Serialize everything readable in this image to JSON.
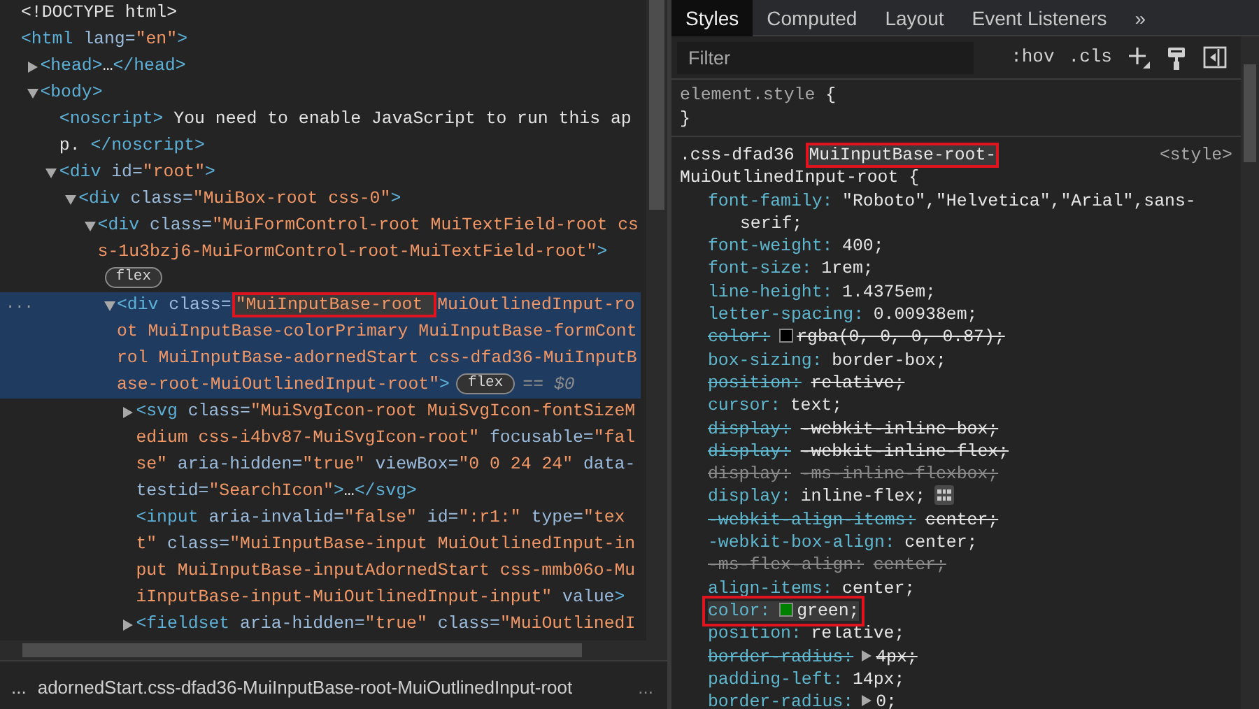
{
  "elements_panel": {
    "row_marker": "...",
    "nodes": [
      {
        "selected": false,
        "segments": [
          {
            "kind": "plain",
            "text": "<!DOCTYPE html>"
          }
        ]
      },
      {
        "selected": false,
        "segments": [
          {
            "kind": "tag",
            "text": "<html"
          },
          {
            "kind": "attr",
            "text": " lang="
          },
          {
            "kind": "value",
            "text": "\"en\""
          },
          {
            "kind": "tag",
            "text": ">"
          }
        ],
        "children": [
          {
            "selected": false,
            "expanded": false,
            "segments": [
              {
                "kind": "tag",
                "text": "<head>"
              },
              {
                "kind": "plain",
                "text": "…"
              },
              {
                "kind": "tag",
                "text": "</head>"
              }
            ]
          },
          {
            "selected": false,
            "expanded": true,
            "segments": [
              {
                "kind": "tag",
                "text": "<body>"
              }
            ],
            "children": [
              {
                "selected": false,
                "segments": [
                  {
                    "kind": "tag",
                    "text": "<noscript>"
                  },
                  {
                    "kind": "plain",
                    "text": " You need to enable JavaScript to run this app. "
                  },
                  {
                    "kind": "tag",
                    "text": "</noscript>"
                  }
                ]
              },
              {
                "selected": false,
                "expanded": true,
                "segments": [
                  {
                    "kind": "tag",
                    "text": "<div"
                  },
                  {
                    "kind": "attr",
                    "text": " id="
                  },
                  {
                    "kind": "value",
                    "text": "\"root\""
                  },
                  {
                    "kind": "tag",
                    "text": ">"
                  }
                ],
                "children": [
                  {
                    "selected": false,
                    "expanded": true,
                    "segments": [
                      {
                        "kind": "tag",
                        "text": "<div"
                      },
                      {
                        "kind": "attr",
                        "text": " class="
                      },
                      {
                        "kind": "value",
                        "text": "\"MuiBox-root css-0\""
                      },
                      {
                        "kind": "tag",
                        "text": ">"
                      }
                    ],
                    "children": [
                      {
                        "selected": false,
                        "expanded": true,
                        "badge": "flex",
                        "segments": [
                          {
                            "kind": "tag",
                            "text": "<div"
                          },
                          {
                            "kind": "attr",
                            "text": " class="
                          },
                          {
                            "kind": "value",
                            "text": "\"MuiFormControl-root MuiTextField-root css-1u3bzj6-MuiFormControl-root-MuiTextField-root\""
                          },
                          {
                            "kind": "tag",
                            "text": ">"
                          }
                        ],
                        "children": [
                          {
                            "selected": true,
                            "expanded": true,
                            "badge": "flex",
                            "suffix": "== $0",
                            "segments": [
                              {
                                "kind": "tag",
                                "text": "<div",
                                "highlighted": false
                              },
                              {
                                "kind": "attr",
                                "text": " class=",
                                "highlighted": false
                              },
                              {
                                "kind": "value",
                                "text": "\"MuiInputBase-root ",
                                "highlighted": true
                              },
                              {
                                "kind": "value",
                                "text": "MuiOutlinedInput-root MuiInputBase-colorPrimary MuiInputBase-formControl MuiInputBase-adornedStart css-dfad36-MuiInputBase-root-MuiOutlinedInput-root\"",
                                "highlighted": false
                              },
                              {
                                "kind": "tag",
                                "text": ">",
                                "highlighted": false
                              }
                            ],
                            "children": [
                              {
                                "selected": false,
                                "expanded": false,
                                "segments": [
                                  {
                                    "kind": "tag",
                                    "text": "<svg"
                                  },
                                  {
                                    "kind": "attr",
                                    "text": " class="
                                  },
                                  {
                                    "kind": "value",
                                    "text": "\"MuiSvgIcon-root MuiSvgIcon-fontSizeMedium css-i4bv87-MuiSvgIcon-root\""
                                  },
                                  {
                                    "kind": "attr",
                                    "text": " focusable="
                                  },
                                  {
                                    "kind": "value",
                                    "text": "\"false\""
                                  },
                                  {
                                    "kind": "attr",
                                    "text": " aria-hidden="
                                  },
                                  {
                                    "kind": "value",
                                    "text": "\"true\""
                                  },
                                  {
                                    "kind": "attr",
                                    "text": " viewBox="
                                  },
                                  {
                                    "kind": "value",
                                    "text": "\"0 0 24 24\""
                                  },
                                  {
                                    "kind": "attr",
                                    "text": " data-testid="
                                  },
                                  {
                                    "kind": "value",
                                    "text": "\"SearchIcon\""
                                  },
                                  {
                                    "kind": "tag",
                                    "text": ">"
                                  },
                                  {
                                    "kind": "plain",
                                    "text": "…"
                                  },
                                  {
                                    "kind": "tag",
                                    "text": "</svg>"
                                  }
                                ]
                              },
                              {
                                "selected": false,
                                "segments": [
                                  {
                                    "kind": "tag",
                                    "text": "<input"
                                  },
                                  {
                                    "kind": "attr",
                                    "text": " aria-invalid="
                                  },
                                  {
                                    "kind": "value",
                                    "text": "\"false\""
                                  },
                                  {
                                    "kind": "attr",
                                    "text": " id="
                                  },
                                  {
                                    "kind": "value",
                                    "text": "\":r1:\""
                                  },
                                  {
                                    "kind": "attr",
                                    "text": " type="
                                  },
                                  {
                                    "kind": "value",
                                    "text": "\"text\""
                                  },
                                  {
                                    "kind": "attr",
                                    "text": " class="
                                  },
                                  {
                                    "kind": "value",
                                    "text": "\"MuiInputBase-input MuiOutlinedInput-input MuiInputBase-inputAdornedStart css-mmb06o-MuiInputBase-input-MuiOutlinedInput-input\""
                                  },
                                  {
                                    "kind": "attr",
                                    "text": " value"
                                  },
                                  {
                                    "kind": "tag",
                                    "text": ">"
                                  }
                                ]
                              },
                              {
                                "selected": false,
                                "expanded": false,
                                "segments": [
                                  {
                                    "kind": "tag",
                                    "text": "<fieldset"
                                  },
                                  {
                                    "kind": "attr",
                                    "text": " aria-hidden="
                                  },
                                  {
                                    "kind": "value",
                                    "text": "\"true\""
                                  },
                                  {
                                    "kind": "attr",
                                    "text": " class="
                                  },
                                  {
                                    "kind": "value",
                                    "text": "\"MuiOutlinedI"
                                  }
                                ]
                              }
                            ]
                          }
                        ]
                      }
                    ]
                  }
                ]
              }
            ]
          }
        ]
      }
    ],
    "breadcrumb": {
      "leading": "...",
      "path": "adornedStart.css-dfad36-MuiInputBase-root-MuiOutlinedInput-root",
      "trailing": "..."
    }
  },
  "styles_panel": {
    "tabs": [
      {
        "label": "Styles",
        "selected": true
      },
      {
        "label": "Computed",
        "selected": false
      },
      {
        "label": "Layout",
        "selected": false
      },
      {
        "label": "Event Listeners",
        "selected": false
      }
    ],
    "more_tabs": "»",
    "filter": {
      "placeholder": "Filter"
    },
    "toolbar_buttons": [
      ":hov",
      ".cls"
    ],
    "rules": [
      {
        "kind": "inline",
        "selector": [
          {
            "text": "element.style",
            "highlighted": false
          }
        ],
        "open": " {",
        "close": "}"
      },
      {
        "kind": "matched",
        "selector": [
          {
            "text": ".css-dfad36 ",
            "highlighted": false
          },
          {
            "text": "MuiInputBase-root-",
            "highlighted": true
          },
          {
            "text": "MuiOutlinedInput-root",
            "highlighted": false
          }
        ],
        "open": " {",
        "source": "<style>",
        "properties": [
          {
            "kind": "plain",
            "name": "font-family:",
            "value": "\"Roboto\",\"Helvetica\",\"Arial\",sans-serif;",
            "overridden": false,
            "invalid": false,
            "highlighted": false
          },
          {
            "kind": "plain",
            "name": "font-weight:",
            "value": "400;",
            "overridden": false,
            "invalid": false,
            "highlighted": false
          },
          {
            "kind": "plain",
            "name": "font-size:",
            "value": "1rem;",
            "overridden": false,
            "invalid": false,
            "highlighted": false
          },
          {
            "kind": "plain",
            "name": "line-height:",
            "value": "1.4375em;",
            "overridden": false,
            "invalid": false,
            "highlighted": false
          },
          {
            "kind": "plain",
            "name": "letter-spacing:",
            "value": "0.00938em;",
            "overridden": false,
            "invalid": false,
            "highlighted": false
          },
          {
            "kind": "swatch",
            "name": "color:",
            "value": "rgba(0, 0, 0, 0.87);",
            "overridden": true,
            "invalid": false,
            "color": "#000000",
            "highlighted": false
          },
          {
            "kind": "plain",
            "name": "box-sizing:",
            "value": "border-box;",
            "overridden": false,
            "invalid": false,
            "highlighted": false
          },
          {
            "kind": "plain",
            "name": "position:",
            "value": "relative;",
            "overridden": true,
            "invalid": false,
            "highlighted": false
          },
          {
            "kind": "plain",
            "name": "cursor:",
            "value": "text;",
            "overridden": false,
            "invalid": false,
            "highlighted": false
          },
          {
            "kind": "plain",
            "name": "display:",
            "value": "-webkit-inline-box;",
            "overridden": true,
            "invalid": false,
            "highlighted": false
          },
          {
            "kind": "plain",
            "name": "display:",
            "value": "-webkit-inline-flex;",
            "overridden": true,
            "invalid": false,
            "highlighted": false
          },
          {
            "kind": "plain",
            "name": "display:",
            "value": "-ms-inline-flexbox;",
            "overridden": true,
            "invalid": true,
            "highlighted": false
          },
          {
            "kind": "flex",
            "name": "display:",
            "value": "inline-flex;",
            "overridden": false,
            "invalid": false,
            "highlighted": false
          },
          {
            "kind": "plain",
            "name": "-webkit-align-items:",
            "value": "center;",
            "overridden": true,
            "invalid": false,
            "highlighted": false
          },
          {
            "kind": "plain",
            "name": "-webkit-box-align:",
            "value": "center;",
            "overridden": false,
            "invalid": false,
            "highlighted": false
          },
          {
            "kind": "plain",
            "name": "-ms-flex-align:",
            "value": "center;",
            "overridden": true,
            "invalid": true,
            "highlighted": false
          },
          {
            "kind": "plain",
            "name": "align-items:",
            "value": "center;",
            "overridden": false,
            "invalid": false,
            "highlighted": false
          },
          {
            "kind": "swatch",
            "name": "color:",
            "value": "green;",
            "overridden": false,
            "invalid": false,
            "color": "#008000",
            "highlighted": true
          },
          {
            "kind": "plain",
            "name": "position:",
            "value": "relative;",
            "overridden": false,
            "invalid": false,
            "highlighted": false
          },
          {
            "kind": "expander",
            "name": "border-radius:",
            "value": "4px;",
            "overridden": true,
            "invalid": false,
            "highlighted": false
          },
          {
            "kind": "plain",
            "name": "padding-left:",
            "value": "14px;",
            "overridden": false,
            "invalid": false,
            "highlighted": false
          },
          {
            "kind": "expander",
            "name": "border-radius:",
            "value": "0;",
            "overridden": false,
            "invalid": false,
            "highlighted": false
          }
        ]
      }
    ]
  }
}
